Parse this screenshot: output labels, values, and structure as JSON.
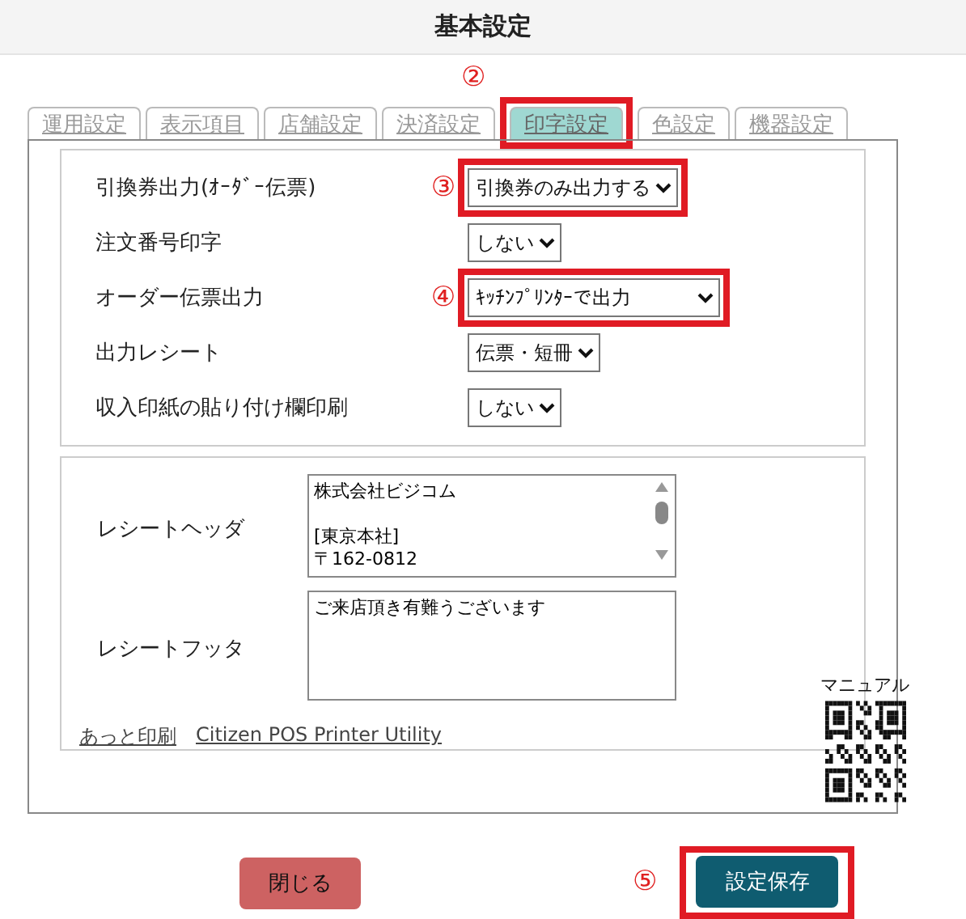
{
  "window": {
    "title": "基本設定"
  },
  "tabs": [
    {
      "label": "運用設定",
      "selected": false
    },
    {
      "label": "表示項目",
      "selected": false
    },
    {
      "label": "店舗設定",
      "selected": false
    },
    {
      "label": "決済設定",
      "selected": false
    },
    {
      "label": "印字設定",
      "selected": true,
      "callout": "②"
    },
    {
      "label": "色設定",
      "selected": false
    },
    {
      "label": "機器設定",
      "selected": false
    }
  ],
  "settings": [
    {
      "label": "引換券出力(ｵｰﾀﾞｰ伝票)",
      "value": "引換券のみ出力する",
      "callout": "③"
    },
    {
      "label": "注文番号印字",
      "value": "しない"
    },
    {
      "label": "オーダー伝票出力",
      "value": "ｷｯﾁﾝﾌﾟﾘﾝﾀｰで出力",
      "callout": "④",
      "wide": true
    },
    {
      "label": "出力レシート",
      "value": "伝票・短冊"
    },
    {
      "label": "収入印紙の貼り付け欄印刷",
      "value": "しない"
    }
  ],
  "receipt": [
    {
      "label": "レシートヘッダ",
      "value": "株式会社ビジコム\n\n[東京本社]\n〒162-0812",
      "scrollbar": true
    },
    {
      "label": "レシートフッタ",
      "value": "ご来店頂き有難うございます"
    }
  ],
  "links": [
    "あっと印刷",
    "Citizen POS Printer Utility"
  ],
  "manual": {
    "label": "マニュアル"
  },
  "buttons": [
    {
      "label": "閉じる",
      "kind": "close"
    },
    {
      "label": "設定保存",
      "kind": "save",
      "callout": "⑤"
    }
  ]
}
